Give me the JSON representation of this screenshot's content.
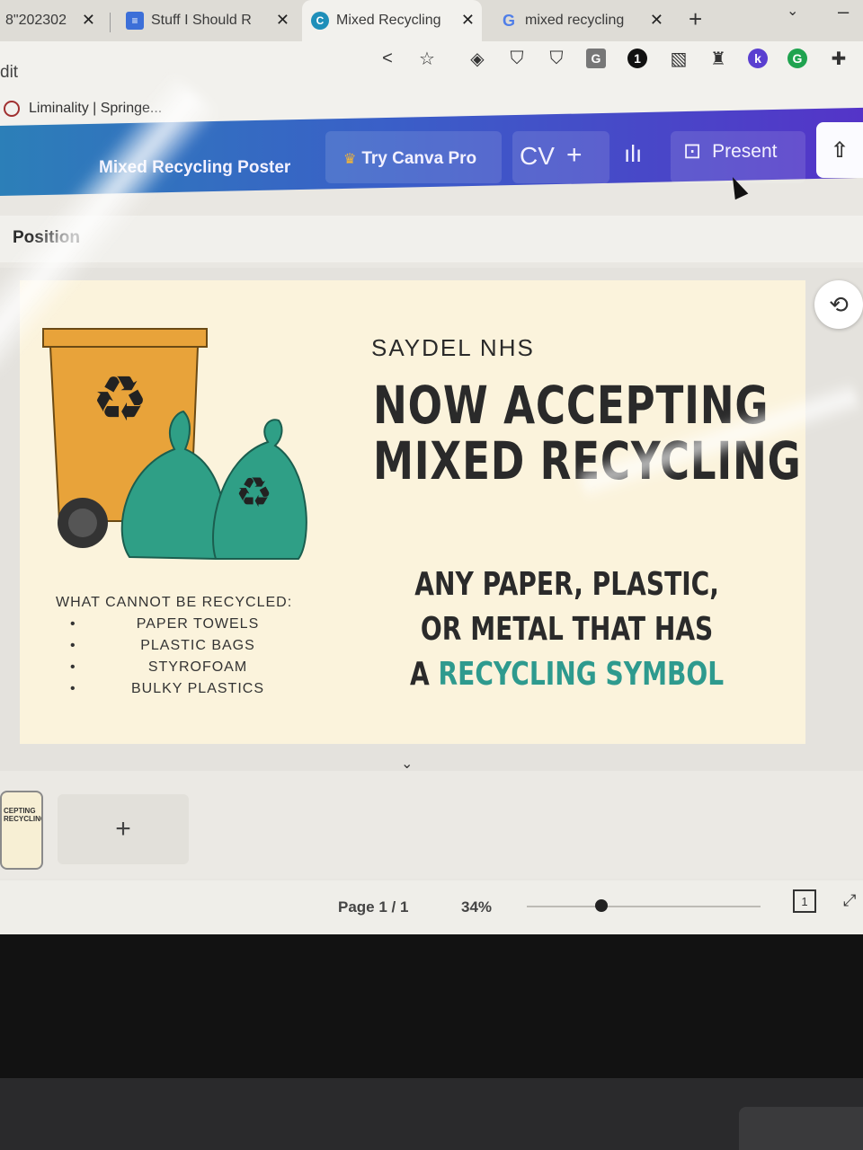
{
  "browser": {
    "tabs": [
      {
        "title": "8\"202302",
        "favicon": "file-icon"
      },
      {
        "title": "Stuff I Should R",
        "favicon": "docs-icon"
      },
      {
        "title": "Mixed Recycling",
        "favicon": "canva-icon",
        "active": true
      },
      {
        "title": "mixed recycling",
        "favicon": "google-icon"
      }
    ],
    "new_tab": "+",
    "close_glyph": "✕",
    "url_fragment": "dit",
    "bookmark": "Liminality | Springe..."
  },
  "canva": {
    "design_title": "Mixed Recycling Poster",
    "try_pro": "Try Canva Pro",
    "avatar_initials": "CV",
    "plus": "+",
    "present": "Present"
  },
  "editor": {
    "position_label": "Position"
  },
  "poster": {
    "org": "SAYDEL NHS",
    "headline_line1": "NOW ACCEPTING",
    "headline_line2": "MIXED RECYCLING",
    "body_line1": "ANY PAPER, PLASTIC,",
    "body_line2": "OR METAL THAT HAS",
    "body_line3_prefix": "A ",
    "body_line3_highlight": "RECYCLING SYMBOL",
    "cannot_title": "WHAT CANNOT BE RECYCLED:",
    "cannot_items": [
      "PAPER TOWELS",
      "PLASTIC BAGS",
      "STYROFOAM",
      "BULKY PLASTICS"
    ],
    "accent_color": "#2e9a8e",
    "bin_color": "#e8a33a",
    "bag_color": "#2f9f86"
  },
  "pages": {
    "thumb_text": "CEPTING RECYCLING",
    "add_page": "+"
  },
  "footer": {
    "page_info": "Page 1 / 1",
    "zoom": "34%",
    "zoom_fraction": 0.32,
    "pages_count": "1"
  }
}
